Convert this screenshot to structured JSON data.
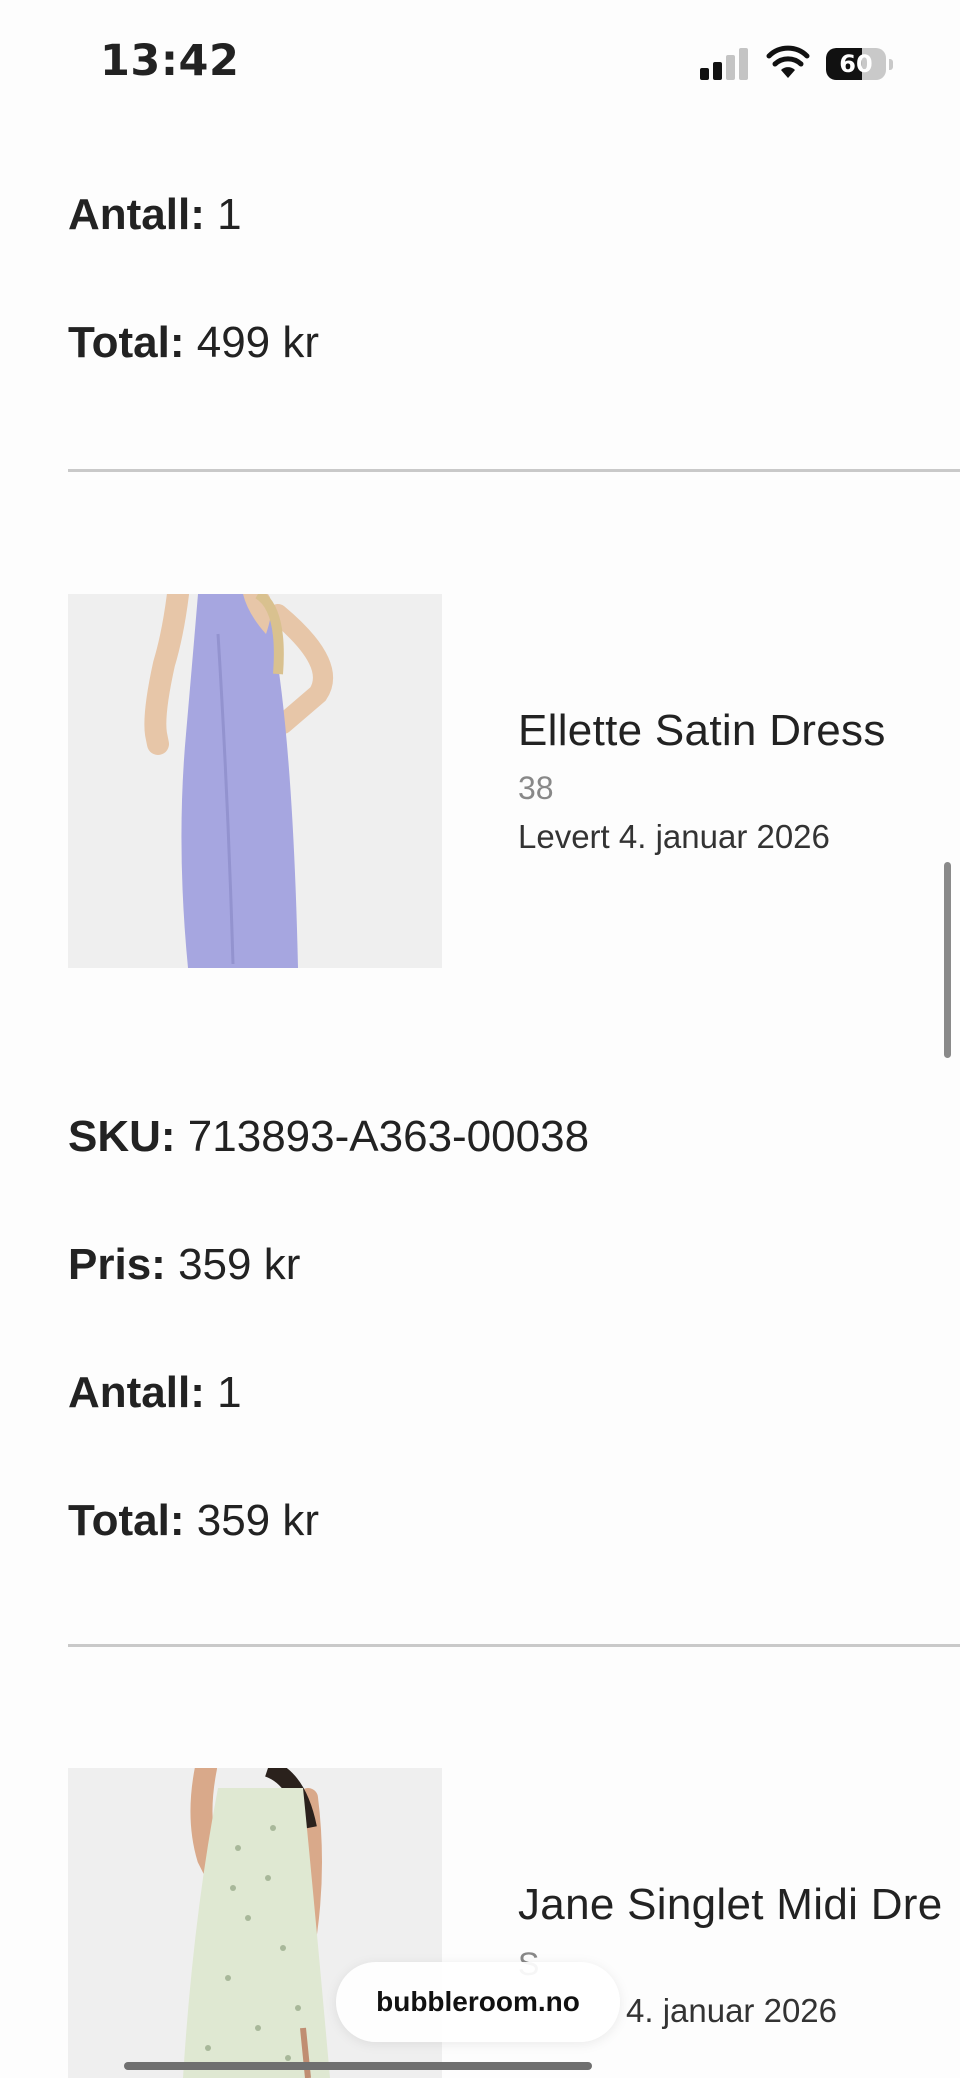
{
  "status_bar": {
    "time": "13:42",
    "battery_percent": "60",
    "battery_level": 0.6,
    "signal_icon": "cellular-signal-icon",
    "wifi_icon": "wifi-icon"
  },
  "previous_item": {
    "antall_label": "Antall:",
    "antall_value": "1",
    "total_label": "Total:",
    "total_value": "499 kr"
  },
  "items": [
    {
      "name": "Ellette Satin Dress",
      "size": "38",
      "delivery": "Levert 4. januar 2026",
      "image_desc": "lavender satin slip dress",
      "dress_color": "#a6a6e0",
      "sku_label": "SKU:",
      "sku_value": "713893-A363-00038",
      "pris_label": "Pris:",
      "pris_value": "359 kr",
      "antall_label": "Antall:",
      "antall_value": "1",
      "total_label": "Total:",
      "total_value": "359 kr"
    },
    {
      "name": "Jane Singlet Midi Dre",
      "size": "S",
      "delivery": "4. januar 2026",
      "image_desc": "light green patterned midi dress",
      "dress_color": "#dfe8d2"
    }
  ],
  "browser": {
    "url": "bubbleroom.no"
  }
}
